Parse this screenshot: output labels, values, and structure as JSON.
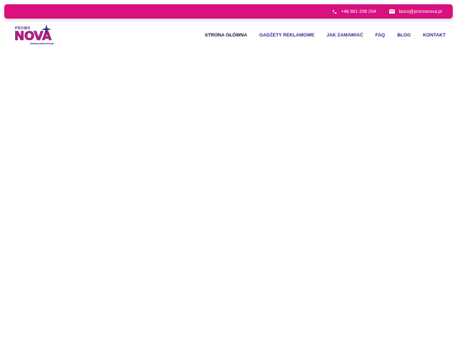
{
  "topbar": {
    "phone": {
      "icon": "phone-icon",
      "text": "+48 881 208 204"
    },
    "email": {
      "icon": "envelope-icon",
      "text": "biuro@promonova.pl"
    },
    "background": "#d9107f"
  },
  "logo": {
    "line1": "PROMO",
    "line2": "NOVA",
    "url": "www.promonova.pl",
    "icon": "star-icon",
    "colors": {
      "primary": "#d9107f",
      "secondary": "#3a2680"
    }
  },
  "nav": {
    "items": [
      {
        "label": "STRONA GŁÓWNA",
        "active": true
      },
      {
        "label": "GADŻETY REKLAMOWE"
      },
      {
        "label": "JAK ZAMAWIAĆ"
      },
      {
        "label": "FAQ"
      },
      {
        "label": "BLOG"
      },
      {
        "label": "KONTAKT"
      }
    ]
  }
}
